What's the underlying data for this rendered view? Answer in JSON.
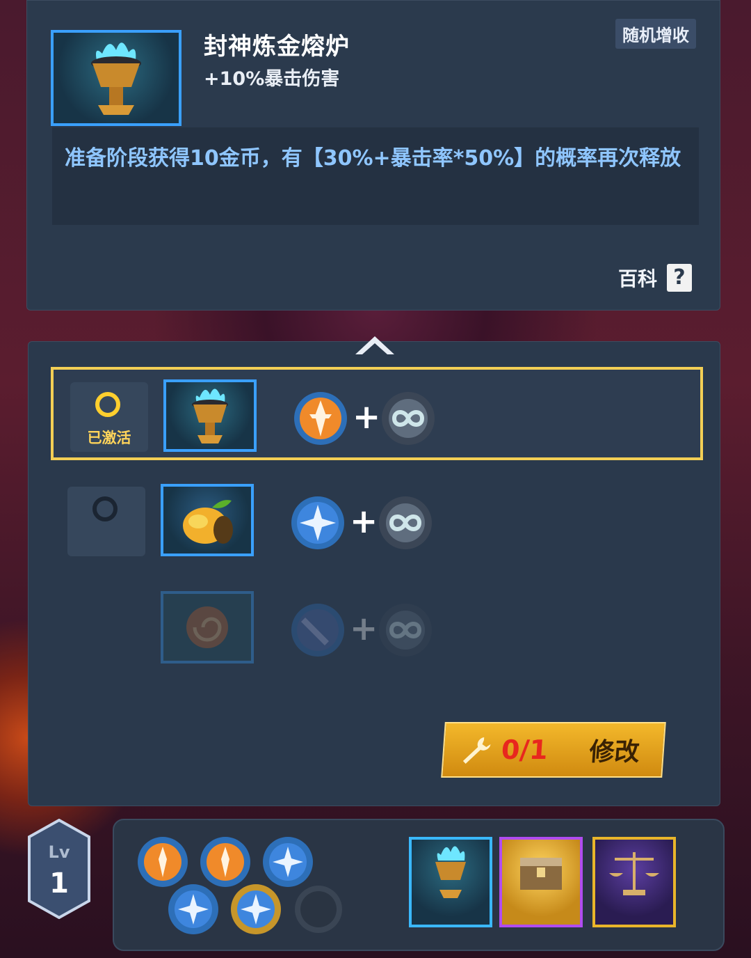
{
  "detail": {
    "title": "封神炼金熔炉",
    "subtitle": "+10%暴击伤害",
    "tag": "随机增收",
    "description": "准备阶段获得10金币，有【30%+暴击率*50%】的概率再次释放",
    "wiki_label": "百科",
    "wiki_icon": "?"
  },
  "list": {
    "rows": [
      {
        "status_label": "已激活",
        "item_icon": "blue-flame-brazier-icon",
        "active": true
      },
      {
        "status_label": "",
        "item_icon": "mango-icon",
        "active": false
      },
      {
        "status_label": "",
        "item_icon": "ammonite-shell-icon",
        "active": false
      }
    ],
    "plus": "+"
  },
  "modify": {
    "count": "0/1",
    "label": "修改",
    "icon": "wrench-icon"
  },
  "level": {
    "label": "Lv",
    "value": "1"
  },
  "colors": {
    "accent_blue": "#3aa0ff",
    "active_gold": "#f3cf55",
    "epic_purple": "#b04cf0",
    "legend_gold": "#e9b52a"
  }
}
